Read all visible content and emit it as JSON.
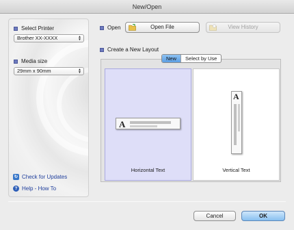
{
  "window": {
    "title": "New/Open"
  },
  "sidebar": {
    "printer": {
      "label": "Select Printer",
      "value": "Brother XX-XXXX"
    },
    "media": {
      "label": "Media size",
      "value": "29mm x 90mm"
    },
    "links": [
      {
        "label": "Check for Updates",
        "icon": "update-icon"
      },
      {
        "label": "Help - How To",
        "icon": "help-icon"
      }
    ]
  },
  "open_section": {
    "label": "Open",
    "open_file_label": "Open File",
    "view_history_label": "View History"
  },
  "create_section": {
    "label": "Create a New Layout",
    "tabs": [
      {
        "label": "New",
        "active": true
      },
      {
        "label": "Select by Use",
        "active": false
      }
    ],
    "options": [
      {
        "label": "Horizontal Text",
        "selected": true
      },
      {
        "label": "Vertical Text",
        "selected": false
      }
    ]
  },
  "footer": {
    "cancel_label": "Cancel",
    "ok_label": "OK"
  },
  "colors": {
    "bullet": "#6e7bbf",
    "selection": "#dedef8",
    "primary_button": "#88bff0"
  }
}
